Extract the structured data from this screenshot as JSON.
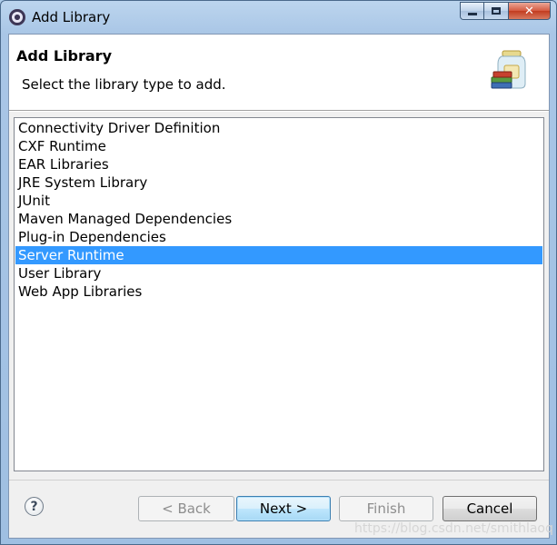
{
  "window": {
    "title": "Add Library"
  },
  "banner": {
    "title": "Add Library",
    "description": "Select the library type to add."
  },
  "library_types": [
    "Connectivity Driver Definition",
    "CXF Runtime",
    "EAR Libraries",
    "JRE System Library",
    "JUnit",
    "Maven Managed Dependencies",
    "Plug-in Dependencies",
    "Server Runtime",
    "User Library",
    "Web App Libraries"
  ],
  "selected_index": 7,
  "buttons": {
    "back": "< Back",
    "next": "Next >",
    "finish": "Finish",
    "cancel": "Cancel",
    "help": "?"
  },
  "watermark": "https://blog.csdn.net/smithlaoq",
  "colors": {
    "selection": "#3399ff",
    "title_bar": "#a9c6e6"
  }
}
